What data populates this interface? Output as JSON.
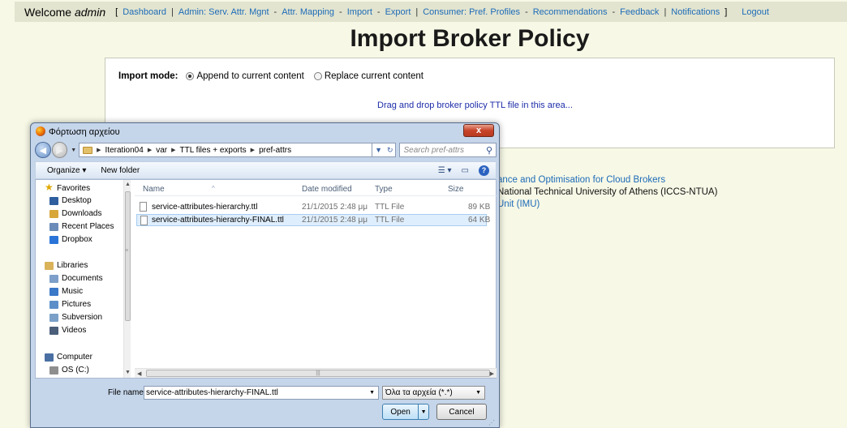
{
  "header": {
    "welcome_prefix": "Welcome",
    "user": "admin",
    "bracket_open": "[",
    "bracket_close": "]",
    "nav": [
      {
        "label": "Dashboard",
        "sep": "|"
      },
      {
        "label": "Admin: Serv. Attr. Mgnt",
        "sep": "-"
      },
      {
        "label": "Attr. Mapping",
        "sep": "-"
      },
      {
        "label": "Import",
        "sep": "-"
      },
      {
        "label": "Export",
        "sep": "|"
      },
      {
        "label": "Consumer: Pref. Profiles",
        "sep": "-"
      },
      {
        "label": "Recommendations",
        "sep": "-"
      },
      {
        "label": "Feedback",
        "sep": "|"
      },
      {
        "label": "Notifications",
        "sep": ""
      }
    ],
    "logout": "Logout"
  },
  "page_title": "Import Broker Policy",
  "import_panel": {
    "mode_label": "Import mode:",
    "options": [
      {
        "label": "Append to current content",
        "selected": true
      },
      {
        "label": "Replace current content",
        "selected": false
      }
    ],
    "dropzone_text": "Drag and drop broker policy TTL file in this area..."
  },
  "footer_fragments": [
    "ance and Optimisation for Cloud Brokers",
    "National Technical University of Athens (ICCS-NTUA)",
    "Unit (IMU)"
  ],
  "dialog": {
    "title": "Φόρτωση αρχείου",
    "close": "x",
    "breadcrumbs": [
      "Iteration04",
      "var",
      "TTL files + exports",
      "pref-attrs"
    ],
    "search_placeholder": "Search pref-attrs",
    "toolbar": {
      "organize": "Organize ▾",
      "new_folder": "New folder"
    },
    "nav_items": [
      {
        "label": "Favorites",
        "icon": "star-icon",
        "indent": 0
      },
      {
        "label": "Desktop",
        "icon": "desktop-icon",
        "indent": 1
      },
      {
        "label": "Downloads",
        "icon": "downloads-icon",
        "indent": 1
      },
      {
        "label": "Recent Places",
        "icon": "recent-places-icon",
        "indent": 1
      },
      {
        "label": "Dropbox",
        "icon": "dropbox-icon",
        "indent": 1
      },
      {
        "label": "Libraries",
        "icon": "libraries-icon",
        "indent": 0
      },
      {
        "label": "Documents",
        "icon": "documents-icon",
        "indent": 1
      },
      {
        "label": "Music",
        "icon": "music-icon",
        "indent": 1
      },
      {
        "label": "Pictures",
        "icon": "pictures-icon",
        "indent": 1
      },
      {
        "label": "Subversion",
        "icon": "subversion-icon",
        "indent": 1
      },
      {
        "label": "Videos",
        "icon": "videos-icon",
        "indent": 1
      },
      {
        "label": "Computer",
        "icon": "computer-icon",
        "indent": 0
      },
      {
        "label": "OS (C:)",
        "icon": "drive-icon",
        "indent": 1
      }
    ],
    "columns": {
      "name": "Name",
      "date": "Date modified",
      "type": "Type",
      "size": "Size"
    },
    "files": [
      {
        "name": "service-attributes-hierarchy.ttl",
        "date": "21/1/2015 2:48 μμ",
        "type": "TTL File",
        "size": "89 KB",
        "selected": false
      },
      {
        "name": "service-attributes-hierarchy-FINAL.ttl",
        "date": "21/1/2015 2:48 μμ",
        "type": "TTL File",
        "size": "64 KB",
        "selected": true
      }
    ],
    "file_name_label": "File name:",
    "file_name_value": "service-attributes-hierarchy-FINAL.ttl",
    "file_type_value": "Όλα τα αρχεία (*.*)",
    "open_label": "Open",
    "cancel_label": "Cancel"
  }
}
